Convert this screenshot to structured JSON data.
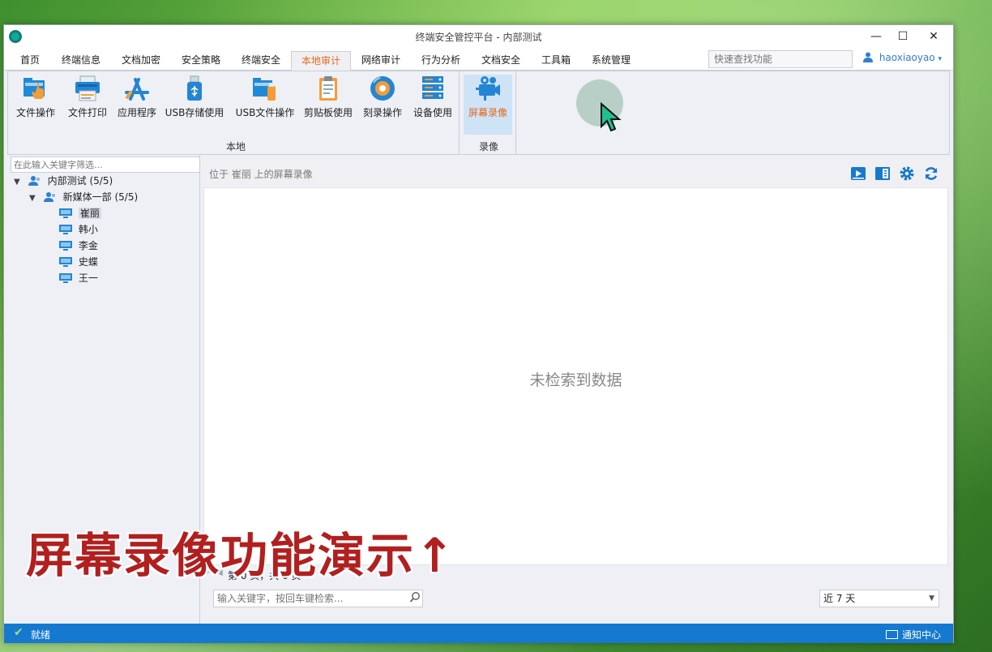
{
  "window": {
    "title": "终端安全管控平台 - 内部测试",
    "minimize": "—",
    "maximize": "☐",
    "close": "✕"
  },
  "menu": {
    "tabs": [
      "首页",
      "终端信息",
      "文档加密",
      "安全策略",
      "终端安全",
      "本地审计",
      "网络审计",
      "行为分析",
      "文档安全",
      "工具箱",
      "系统管理"
    ],
    "active_tab": "本地审计",
    "quick_search_placeholder": "快速查找功能",
    "username": "haoxiaoyao",
    "user_chevron": "▾"
  },
  "ribbon": {
    "local_buttons": [
      {
        "label": "文件操作",
        "icon": "folder-hand-icon"
      },
      {
        "label": "文件打印",
        "icon": "printer-icon"
      },
      {
        "label": "应用程序",
        "icon": "app-store-icon"
      },
      {
        "label": "USB存储使用",
        "icon": "usb-drive-icon"
      },
      {
        "label": "USB文件操作",
        "icon": "usb-folder-icon"
      },
      {
        "label": "剪贴板使用",
        "icon": "clipboard-icon"
      },
      {
        "label": "刻录操作",
        "icon": "disc-burn-icon"
      },
      {
        "label": "设备使用",
        "icon": "device-server-icon"
      }
    ],
    "local_group_label": "本地",
    "record_button": {
      "label": "屏幕录像",
      "icon": "video-camera-icon"
    },
    "record_group_label": "录像"
  },
  "left_panel": {
    "filter_placeholder": "在此输入关键字筛选...",
    "tree": [
      {
        "label": "内部测试 (5/5)",
        "level": 0,
        "type": "group"
      },
      {
        "label": "新媒体一部 (5/5)",
        "level": 1,
        "type": "group"
      },
      {
        "label": "崔丽",
        "level": 2,
        "type": "computer",
        "selected": true
      },
      {
        "label": "韩小",
        "level": 2,
        "type": "computer"
      },
      {
        "label": "李金",
        "level": 2,
        "type": "computer"
      },
      {
        "label": "史蝶",
        "level": 2,
        "type": "computer"
      },
      {
        "label": "王一",
        "level": 2,
        "type": "computer"
      }
    ]
  },
  "right_panel": {
    "caption": "位于 崔丽 上的屏幕录像",
    "empty_message": "未检索到数据",
    "pager_text": "第 0 页，共 0 页",
    "pager_prev": "⏮ ◀",
    "pager_next": "▶ ⏭",
    "search_placeholder": "输入关键字，按回车键检索...",
    "range_value": "近 7 天",
    "range_chevron": "▼"
  },
  "status": {
    "text": "就绪",
    "check": "✔",
    "notify_label": "通知中心"
  },
  "overlay": {
    "caption": "屏幕录像功能演示↑"
  },
  "colors": {
    "accent": "#1579d0",
    "active_tab": "#e0691b",
    "caption_red": "#b21f1f"
  }
}
